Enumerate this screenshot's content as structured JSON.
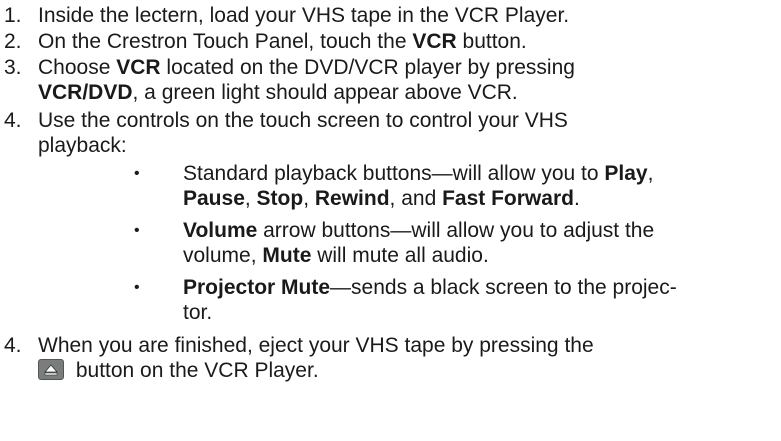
{
  "steps": [
    {
      "number": "1.",
      "lines": [
        [
          "Inside the lectern, load your VHS tape in the VCR Player."
        ]
      ]
    },
    {
      "number": "2.",
      "line1_pre": "On the Crestron Touch Panel, touch the ",
      "line1_bold": "VCR",
      "line1_post": " button."
    },
    {
      "number": "3.",
      "line1_pre": "Choose ",
      "line1_bold": "VCR",
      "line1_post": " located on the DVD/VCR player by pressing",
      "line2_bold": "VCR/DVD",
      "line2_post": ", a green light should appear above VCR."
    },
    {
      "number": "4.",
      "line1": "Use the controls on the touch screen to control your VHS",
      "line2": "playback:"
    },
    {
      "number": "4.",
      "line1": "When you are finished, eject your VHS tape by pressing the",
      "line2_post": " button on the VCR Player."
    }
  ],
  "bullets": [
    {
      "symbol": "•",
      "l1_pre": "Standard playback buttons—will allow you to ",
      "l1_bold": "Play",
      "l1_post": ",",
      "l2_b1": "Pause",
      "l2_s1": ", ",
      "l2_b2": "Stop",
      "l2_s2": ", ",
      "l2_b3": "Rewind",
      "l2_s3": ", and ",
      "l2_b4": "Fast Forward",
      "l2_s4": "."
    },
    {
      "symbol": "•",
      "l1_bold": "Volume",
      "l1_post": " arrow buttons—will allow you to adjust the",
      "l2_pre": "volume, ",
      "l2_bold": "Mute",
      "l2_post": " will mute all audio."
    },
    {
      "symbol": "•",
      "l1_bold": "Projector Mute",
      "l1_post": "—sends a black screen to the projec-",
      "l2": "tor."
    }
  ],
  "icons": {
    "eject": "eject-icon"
  }
}
